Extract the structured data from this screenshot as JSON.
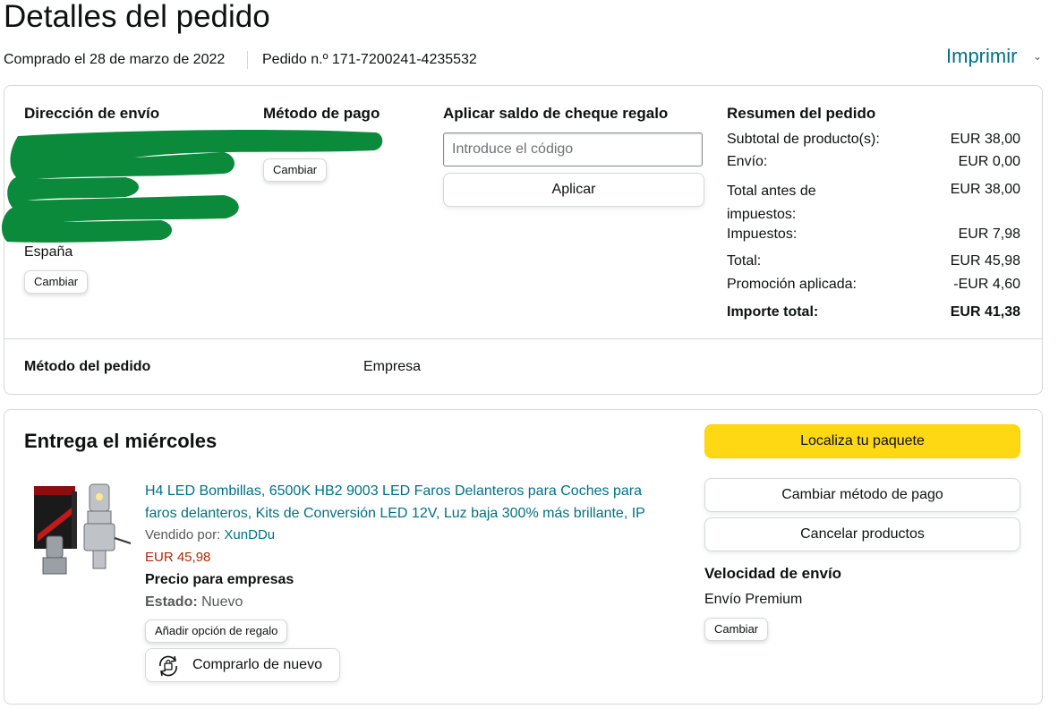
{
  "header": {
    "title": "Detalles del pedido",
    "purchase_date": "Comprado el 28 de marzo de 2022",
    "order_number": "Pedido n.º 171-7200241-4235532",
    "print_label": "Imprimir"
  },
  "shipping": {
    "heading": "Dirección de envío",
    "country": "España",
    "change_label": "Cambiar"
  },
  "payment": {
    "heading": "Método de pago",
    "change_label": "Cambiar"
  },
  "gift_card": {
    "heading": "Aplicar saldo de cheque regalo",
    "placeholder": "Introduce el código",
    "apply_label": "Aplicar"
  },
  "summary": {
    "heading": "Resumen del pedido",
    "rows": [
      {
        "label": "Subtotal de producto(s):",
        "value": "EUR 38,00"
      },
      {
        "label": "Envío:",
        "value": "EUR 0,00"
      },
      {
        "label": "Total antes de impuestos:",
        "value": "EUR 38,00"
      },
      {
        "label": "Impuestos:",
        "value": "EUR 7,98"
      },
      {
        "label": "Total:",
        "value": "EUR 45,98"
      },
      {
        "label": "Promoción aplicada:",
        "value": "-EUR 4,60"
      },
      {
        "label": "Importe total:",
        "value": "EUR 41,38"
      }
    ]
  },
  "order_method": {
    "label": "Método del pedido",
    "value": "Empresa"
  },
  "delivery": {
    "heading": "Entrega el miércoles",
    "track_label": "Localiza tu paquete",
    "change_payment_label": "Cambiar método de pago",
    "cancel_label": "Cancelar productos",
    "speed_heading": "Velocidad de envío",
    "speed_value": "Envío Premium",
    "speed_change_label": "Cambiar"
  },
  "product": {
    "title": "H4 LED Bombillas, 6500K HB2 9003 LED Faros Delanteros para Coches para faros delanteros, Kits de Conversión LED 12V, Luz baja 300% más brillante, IP",
    "sold_by_label": "Vendido por:",
    "seller": "XunDDu",
    "price": "EUR 45,98",
    "business_price": "Precio para empresas",
    "condition_label": "Estado:",
    "condition_value": "Nuevo",
    "gift_option_label": "Añadir opción de regalo",
    "buy_again_label": "Comprarlo de nuevo",
    "image_icon": "led-bulb-product-image"
  },
  "colors": {
    "link": "#007185",
    "primary_button": "#ffd814",
    "price": "#b12704",
    "redaction": "#0a8a3a"
  }
}
